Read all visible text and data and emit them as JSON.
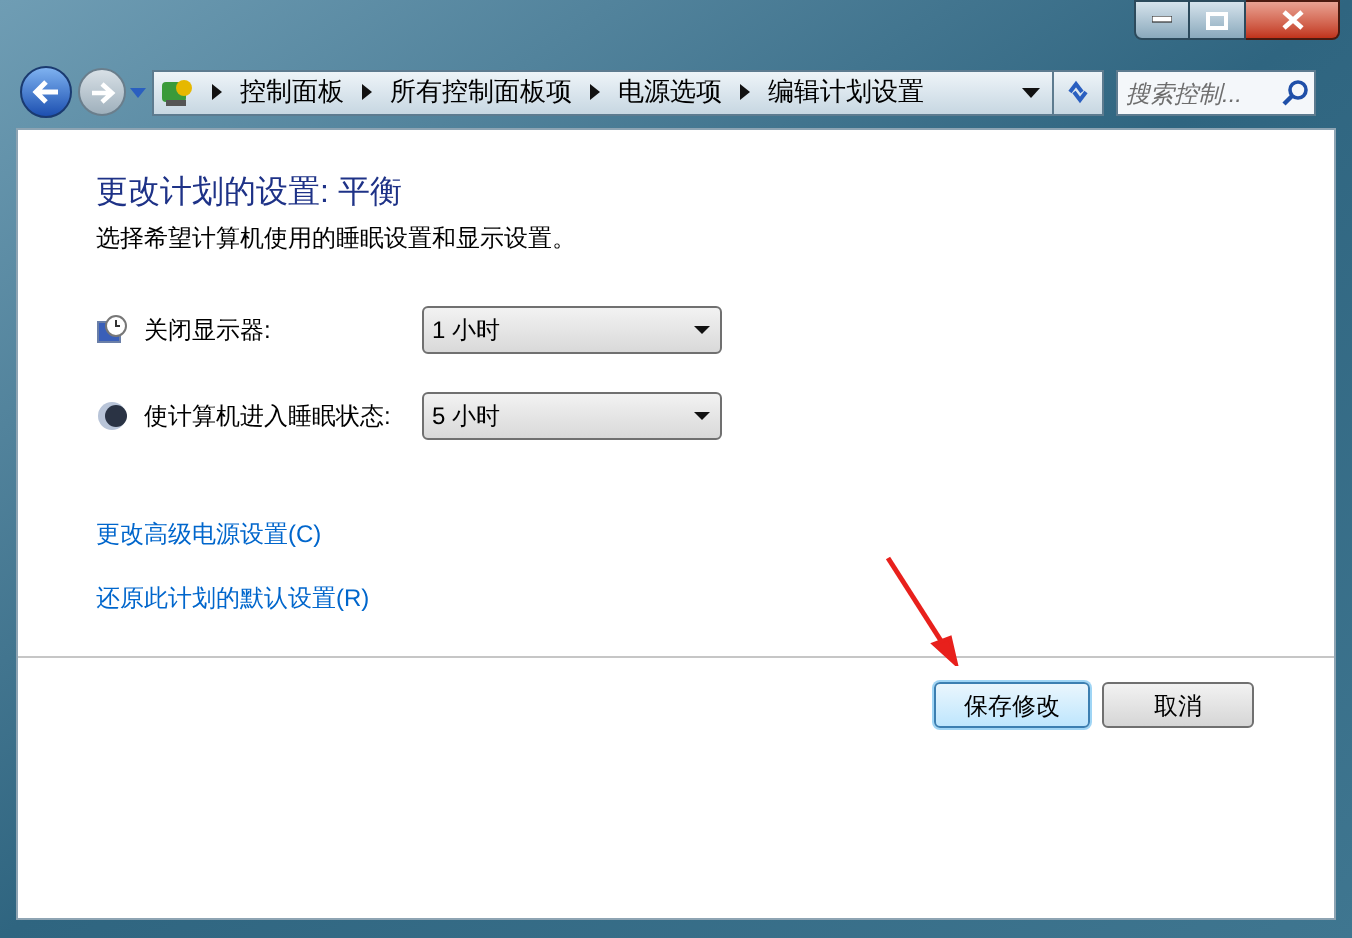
{
  "address_bar": {
    "breadcrumbs": [
      "控制面板",
      "所有控制面板项",
      "电源选项",
      "编辑计划设置"
    ]
  },
  "search": {
    "placeholder": "搜索控制..."
  },
  "heading": "更改计划的设置: 平衡",
  "description": "选择希望计算机使用的睡眠设置和显示设置。",
  "settings": [
    {
      "kind": "display",
      "label": "关闭显示器:",
      "value": "1 小时"
    },
    {
      "kind": "sleep",
      "label": "使计算机进入睡眠状态:",
      "value": "5 小时"
    }
  ],
  "links": [
    "更改高级电源设置(C)",
    "还原此计划的默认设置(R)"
  ],
  "buttons": [
    {
      "label": "保存修改",
      "default": true
    },
    {
      "label": "取消",
      "default": false
    }
  ]
}
